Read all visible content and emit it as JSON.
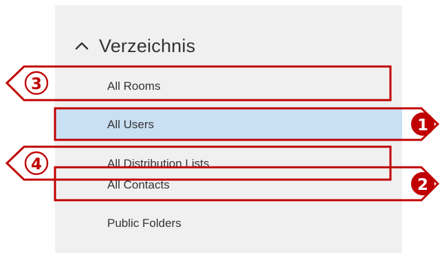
{
  "directory": {
    "title": "Verzeichnis",
    "items": [
      {
        "label": "All Rooms",
        "selected": false
      },
      {
        "label": "All Users",
        "selected": true
      },
      {
        "label": "All Distribution Lists",
        "selected": false
      },
      {
        "label": "All Contacts",
        "selected": false
      },
      {
        "label": "Public Folders",
        "selected": false
      }
    ]
  },
  "callouts": [
    {
      "number": "3",
      "target": "All Rooms",
      "style": "outline"
    },
    {
      "number": "1",
      "target": "All Users",
      "style": "filled"
    },
    {
      "number": "4",
      "target": "All Distribution Lists",
      "style": "outline"
    },
    {
      "number": "2",
      "target": "All Contacts",
      "style": "filled"
    }
  ],
  "colors": {
    "panel_background": "#f0f0f0",
    "selected_background": "#c9dff2",
    "callout_red": "#c00000",
    "text": "#333333"
  },
  "icons": {
    "section_toggle": "chevron-up-icon"
  }
}
